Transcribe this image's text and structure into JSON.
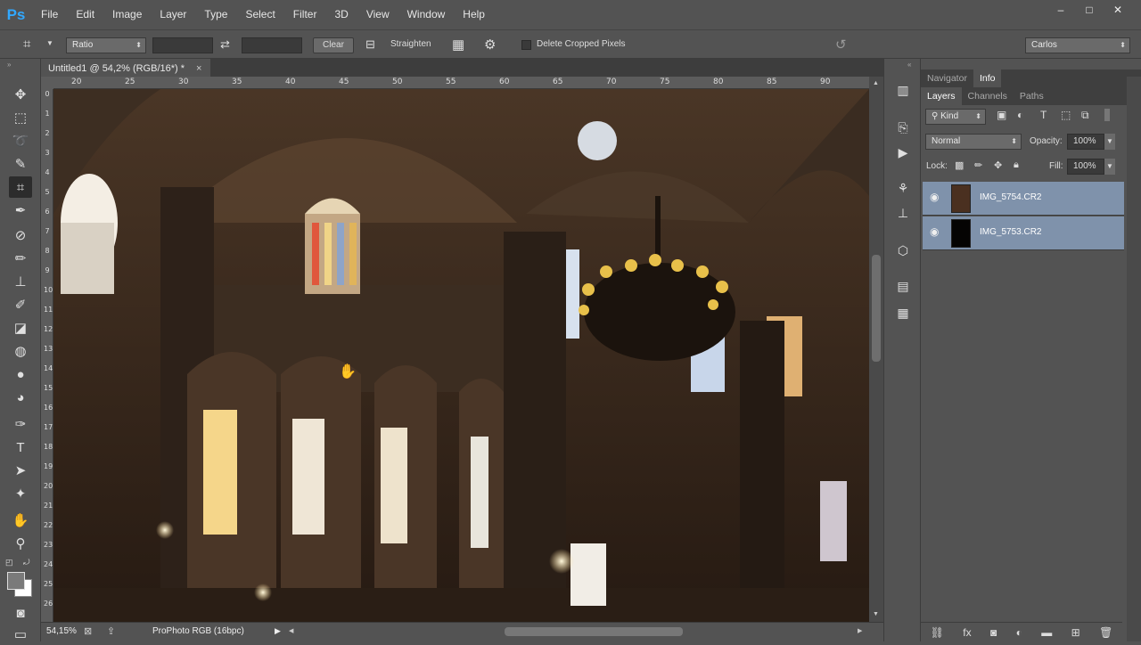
{
  "app": {
    "logo": "Ps"
  },
  "menu": [
    "File",
    "Edit",
    "Image",
    "Layer",
    "Type",
    "Select",
    "Filter",
    "3D",
    "View",
    "Window",
    "Help"
  ],
  "window_controls": [
    "–",
    "□",
    "✕"
  ],
  "options": {
    "ratio_label": "Ratio",
    "clear_label": "Clear",
    "straighten_label": "Straighten",
    "delete_cropped_label": "Delete Cropped Pixels",
    "workspace": "Carlos"
  },
  "document": {
    "tab_title": "Untitled1 @ 54,2% (RGB/16*) *",
    "ruler_top_ticks": [
      "20",
      "25",
      "30",
      "35",
      "40",
      "45",
      "50",
      "55",
      "60",
      "65",
      "70",
      "75",
      "80",
      "85",
      "90"
    ],
    "ruler_left_ticks": [
      "0",
      "1",
      "2",
      "3",
      "4",
      "5",
      "6",
      "7",
      "8",
      "9",
      "10",
      "11",
      "12",
      "13",
      "14",
      "15",
      "16",
      "17",
      "18",
      "19",
      "20",
      "21",
      "22",
      "23",
      "24",
      "25",
      "26"
    ],
    "zoom": "54,15%",
    "color_profile": "ProPhoto RGB (16bpc)"
  },
  "panels": {
    "top_tabs": [
      "Navigator",
      "Info"
    ],
    "top_active": "Info",
    "layer_tabs": [
      "Layers",
      "Channels",
      "Paths"
    ],
    "layer_tabs_active": "Layers",
    "kind_label": "Kind",
    "blend_mode": "Normal",
    "opacity_label": "Opacity:",
    "opacity_value": "100%",
    "lock_label": "Lock:",
    "fill_label": "Fill:",
    "fill_value": "100%",
    "layers": [
      {
        "name": "IMG_5754.CR2"
      },
      {
        "name": "IMG_5753.CR2"
      }
    ]
  },
  "colors": {
    "selected_layer": "#7f92ab",
    "ps_blue": "#31a8ff"
  }
}
